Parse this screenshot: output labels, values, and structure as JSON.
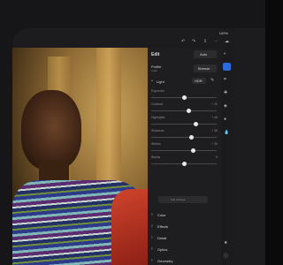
{
  "status": {
    "battery": "100%"
  },
  "header": {
    "title": "Edit",
    "auto_label": "Auto"
  },
  "profile": {
    "label": "Profile",
    "value": "Color",
    "browse_label": "Browse"
  },
  "light": {
    "label": "Light",
    "hdr_label": "HDR"
  },
  "sliders": [
    {
      "label": "Exposure",
      "value": "",
      "pct": 0.5
    },
    {
      "label": "Contrast",
      "value": "+ 20",
      "pct": 0.58
    },
    {
      "label": "Highlights",
      "value": "+ 45",
      "pct": 0.68
    },
    {
      "label": "Shadows",
      "value": "+ 35",
      "pct": 0.62
    },
    {
      "label": "Whites",
      "value": "+ 39",
      "pct": 0.64
    },
    {
      "label": "Blacks",
      "value": "0",
      "pct": 0.5
    }
  ],
  "edit_settings_label": "Edit settings",
  "sections": [
    "Color",
    "Effects",
    "Detail",
    "Optics",
    "Geometry"
  ]
}
